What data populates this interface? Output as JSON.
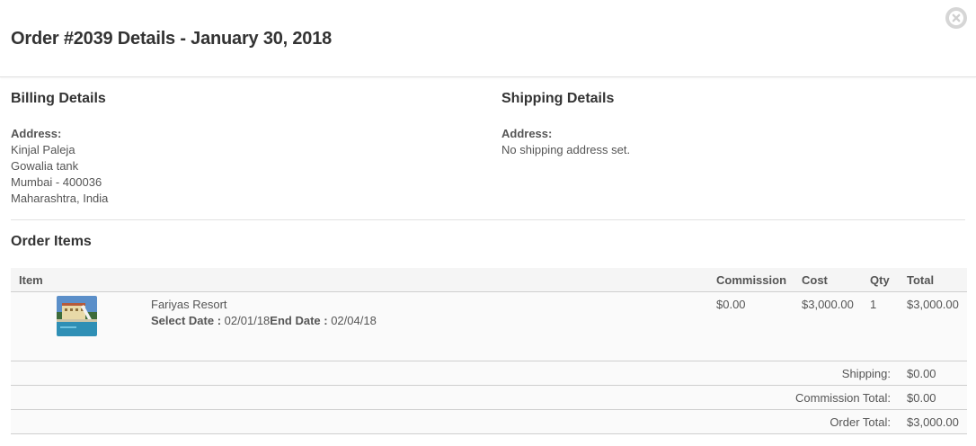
{
  "modal": {
    "title": "Order #2039 Details - January 30, 2018"
  },
  "billing": {
    "heading": "Billing Details",
    "address_label": "Address:",
    "lines": [
      "Kinjal Paleja",
      "Gowalia tank",
      "Mumbai - 400036",
      "Maharashtra, India"
    ]
  },
  "shipping": {
    "heading": "Shipping Details",
    "address_label": "Address:",
    "text": "No shipping address set."
  },
  "order_items": {
    "heading": "Order Items",
    "columns": {
      "item": "Item",
      "commission": "Commission",
      "cost": "Cost",
      "qty": "Qty",
      "total": "Total"
    },
    "rows": [
      {
        "name": "Fariyas Resort",
        "select_date_label": "Select Date :",
        "select_date": "02/01/18",
        "end_date_label": "End Date :",
        "end_date": "02/04/18",
        "commission": "$0.00",
        "cost": "$3,000.00",
        "qty": "1",
        "total": "$3,000.00"
      }
    ],
    "totals": [
      {
        "label": "Shipping:",
        "value": "$0.00"
      },
      {
        "label": "Commission Total:",
        "value": "$0.00"
      },
      {
        "label": "Order Total:",
        "value": "$3,000.00"
      }
    ]
  },
  "icons": {
    "close": "close-icon",
    "thumbnail": "resort-thumbnail"
  },
  "colors": {
    "heading": "#333333",
    "text": "#555555",
    "header_row_bg": "#f5f5f5",
    "row_bg": "#fafafa",
    "divider": "#cfcfcf",
    "close_button": "#d6d6d6"
  }
}
